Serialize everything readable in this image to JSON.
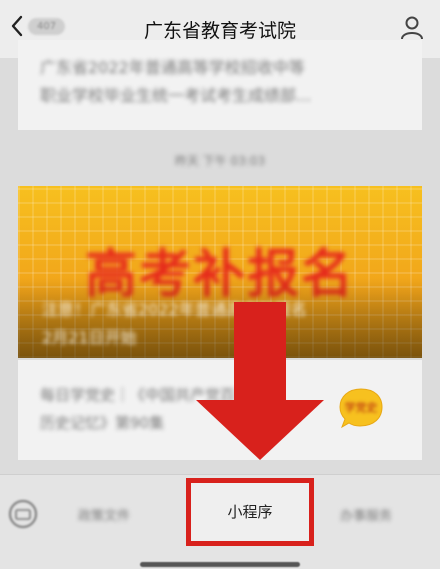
{
  "header": {
    "title": "广东省教育考试院",
    "unread": "407"
  },
  "cards": {
    "top": {
      "line1": "广东省2022年普通高等学校招收中等",
      "line2": "职业学校毕业生统一考试考生成绩部..."
    },
    "timestamp": "昨天 下午 03:03",
    "banner": {
      "title": "高考补报名",
      "caption1": "注意！广东省2022年普通高考补报名",
      "caption2": "2月21日开始"
    },
    "study": {
      "line1": "每日学党史｜《中国共产党百年",
      "line2": "历史记忆》第90集",
      "badge": "学党史"
    }
  },
  "bottom_menu": {
    "left": "政策文件",
    "center": "小程序",
    "right": "办事服务"
  },
  "colors": {
    "highlight": "#d8211c",
    "banner": "#f4a41a",
    "banner_title": "#e52a1b"
  }
}
